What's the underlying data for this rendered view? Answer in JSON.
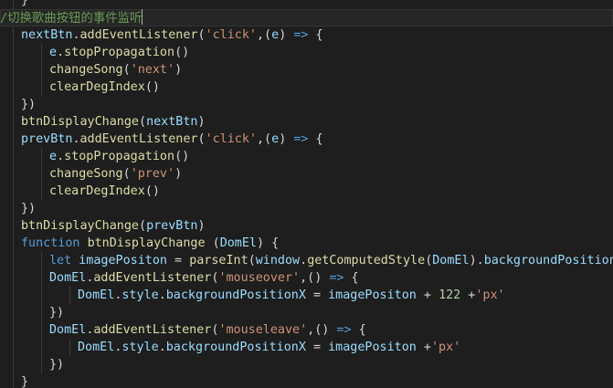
{
  "editor": {
    "theme_colors": {
      "background": "#1e1e1e",
      "comment": "#6a9955",
      "variable": "#9cdcfe",
      "function": "#dcdcaa",
      "string": "#ce9178",
      "keyword": "#569cd6",
      "number": "#b5cea8",
      "punctuation": "#d4d4d4"
    },
    "current_line": 1,
    "lines": [
      {
        "indent": 1,
        "tokens": [
          [
            "punc",
            "}"
          ]
        ]
      },
      {
        "indent": 0,
        "tokens": [
          [
            "comment",
            "//切换歌曲按钮的事件监听"
          ]
        ]
      },
      {
        "indent": 1,
        "tokens": [
          [
            "var",
            "nextBtn"
          ],
          [
            "punc",
            "."
          ],
          [
            "fn",
            "addEventListener"
          ],
          [
            "punc",
            "("
          ],
          [
            "str",
            "'click'"
          ],
          [
            "punc",
            ",("
          ],
          [
            "var",
            "e"
          ],
          [
            "punc",
            ") "
          ],
          [
            "kw",
            "=>"
          ],
          [
            "punc",
            " {"
          ]
        ]
      },
      {
        "indent": 2,
        "tokens": [
          [
            "var",
            "e"
          ],
          [
            "punc",
            "."
          ],
          [
            "fn",
            "stopPropagation"
          ],
          [
            "punc",
            "()"
          ]
        ]
      },
      {
        "indent": 2,
        "tokens": [
          [
            "fn",
            "changeSong"
          ],
          [
            "punc",
            "("
          ],
          [
            "str",
            "'next'"
          ],
          [
            "punc",
            ")"
          ]
        ]
      },
      {
        "indent": 2,
        "tokens": [
          [
            "fn",
            "clearDegIndex"
          ],
          [
            "punc",
            "()"
          ]
        ]
      },
      {
        "indent": 1,
        "tokens": [
          [
            "punc",
            "})"
          ]
        ]
      },
      {
        "indent": 1,
        "tokens": [
          [
            "fn",
            "btnDisplayChange"
          ],
          [
            "punc",
            "("
          ],
          [
            "var",
            "nextBtn"
          ],
          [
            "punc",
            ")"
          ]
        ]
      },
      {
        "indent": 1,
        "tokens": [
          [
            "var",
            "prevBtn"
          ],
          [
            "punc",
            "."
          ],
          [
            "fn",
            "addEventListener"
          ],
          [
            "punc",
            "("
          ],
          [
            "str",
            "'click'"
          ],
          [
            "punc",
            ",("
          ],
          [
            "var",
            "e"
          ],
          [
            "punc",
            ") "
          ],
          [
            "kw",
            "=>"
          ],
          [
            "punc",
            " {"
          ]
        ]
      },
      {
        "indent": 2,
        "tokens": [
          [
            "var",
            "e"
          ],
          [
            "punc",
            "."
          ],
          [
            "fn",
            "stopPropagation"
          ],
          [
            "punc",
            "()"
          ]
        ]
      },
      {
        "indent": 2,
        "tokens": [
          [
            "fn",
            "changeSong"
          ],
          [
            "punc",
            "("
          ],
          [
            "str",
            "'prev'"
          ],
          [
            "punc",
            ")"
          ]
        ]
      },
      {
        "indent": 2,
        "tokens": [
          [
            "fn",
            "clearDegIndex"
          ],
          [
            "punc",
            "()"
          ]
        ]
      },
      {
        "indent": 1,
        "tokens": [
          [
            "punc",
            "})"
          ]
        ]
      },
      {
        "indent": 1,
        "tokens": [
          [
            "fn",
            "btnDisplayChange"
          ],
          [
            "punc",
            "("
          ],
          [
            "var",
            "prevBtn"
          ],
          [
            "punc",
            ")"
          ]
        ]
      },
      {
        "indent": 1,
        "tokens": [
          [
            "kw",
            "function"
          ],
          [
            "punc",
            " "
          ],
          [
            "fn",
            "btnDisplayChange"
          ],
          [
            "punc",
            " ("
          ],
          [
            "var",
            "DomEl"
          ],
          [
            "punc",
            ") {"
          ]
        ]
      },
      {
        "indent": 2,
        "tokens": [
          [
            "kw",
            "let"
          ],
          [
            "punc",
            " "
          ],
          [
            "var",
            "imagePositon"
          ],
          [
            "punc",
            " = "
          ],
          [
            "fn",
            "parseInt"
          ],
          [
            "punc",
            "("
          ],
          [
            "var",
            "window"
          ],
          [
            "punc",
            "."
          ],
          [
            "fn",
            "getComputedStyle"
          ],
          [
            "punc",
            "("
          ],
          [
            "var",
            "DomEl"
          ],
          [
            "punc",
            ")."
          ],
          [
            "var",
            "backgroundPositionX"
          ],
          [
            "punc",
            ")"
          ]
        ]
      },
      {
        "indent": 2,
        "tokens": [
          [
            "var",
            "DomEl"
          ],
          [
            "punc",
            "."
          ],
          [
            "fn",
            "addEventListener"
          ],
          [
            "punc",
            "("
          ],
          [
            "str",
            "'mouseover'"
          ],
          [
            "punc",
            ",() "
          ],
          [
            "kw",
            "=>"
          ],
          [
            "punc",
            " {"
          ]
        ]
      },
      {
        "indent": 3,
        "tokens": [
          [
            "var",
            "DomEl"
          ],
          [
            "punc",
            "."
          ],
          [
            "var",
            "style"
          ],
          [
            "punc",
            "."
          ],
          [
            "var",
            "backgroundPositionX"
          ],
          [
            "punc",
            " = "
          ],
          [
            "var",
            "imagePositon"
          ],
          [
            "punc",
            " + "
          ],
          [
            "num",
            "122"
          ],
          [
            "punc",
            " +"
          ],
          [
            "str",
            "'px'"
          ]
        ]
      },
      {
        "indent": 2,
        "tokens": [
          [
            "punc",
            "})"
          ]
        ]
      },
      {
        "indent": 2,
        "tokens": [
          [
            "var",
            "DomEl"
          ],
          [
            "punc",
            "."
          ],
          [
            "fn",
            "addEventListener"
          ],
          [
            "punc",
            "("
          ],
          [
            "str",
            "'mouseleave'"
          ],
          [
            "punc",
            ",() "
          ],
          [
            "kw",
            "=>"
          ],
          [
            "punc",
            " {"
          ]
        ]
      },
      {
        "indent": 3,
        "tokens": [
          [
            "var",
            "DomEl"
          ],
          [
            "punc",
            "."
          ],
          [
            "var",
            "style"
          ],
          [
            "punc",
            "."
          ],
          [
            "var",
            "backgroundPositionX"
          ],
          [
            "punc",
            " = "
          ],
          [
            "var",
            "imagePositon"
          ],
          [
            "punc",
            " +"
          ],
          [
            "str",
            "'px'"
          ]
        ]
      },
      {
        "indent": 2,
        "tokens": [
          [
            "punc",
            "})"
          ]
        ]
      },
      {
        "indent": 1,
        "tokens": [
          [
            "punc",
            "}"
          ]
        ]
      }
    ]
  }
}
